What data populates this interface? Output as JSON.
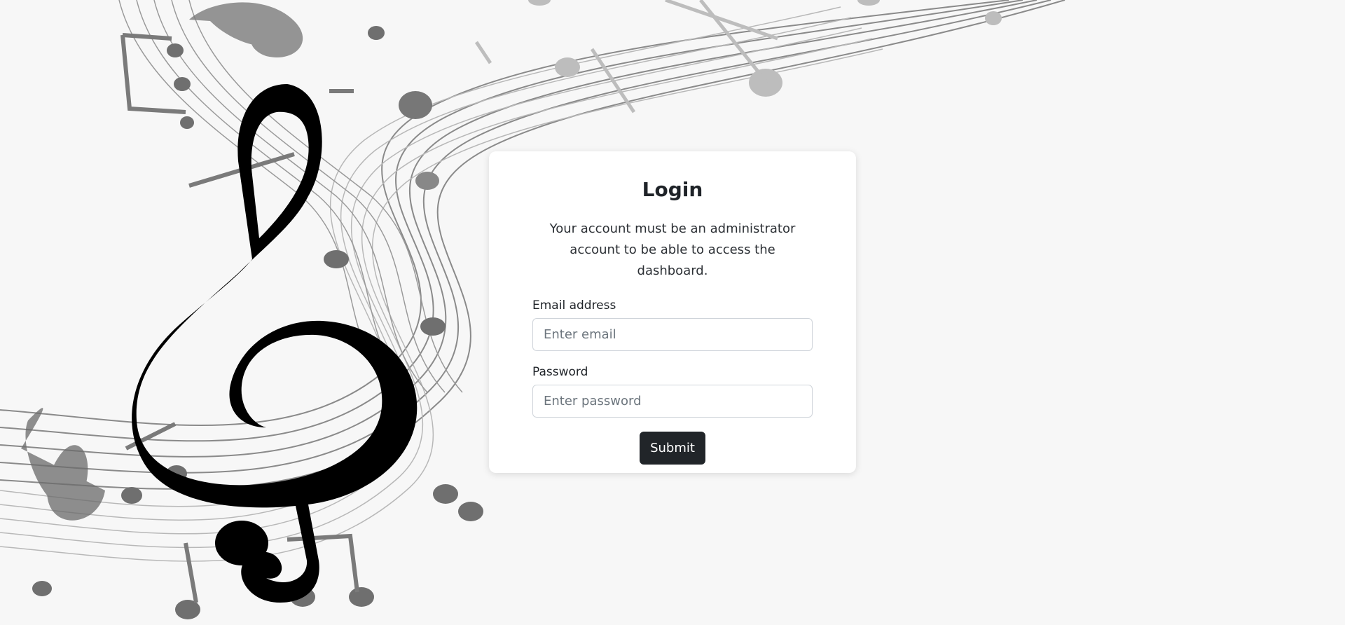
{
  "login": {
    "title": "Login",
    "description": "Your account must be an administrator account to be able to access the dashboard.",
    "email_label": "Email address",
    "email_placeholder": "Enter email",
    "email_value": "",
    "password_label": "Password",
    "password_placeholder": "Enter password",
    "password_value": "",
    "submit_label": "Submit"
  },
  "background": {
    "image": "music-staff-treble-clef-illustration"
  },
  "colors": {
    "page_background": "#f7f7f7",
    "card_background": "#ffffff",
    "button_background": "#212529",
    "button_text": "#ffffff"
  }
}
